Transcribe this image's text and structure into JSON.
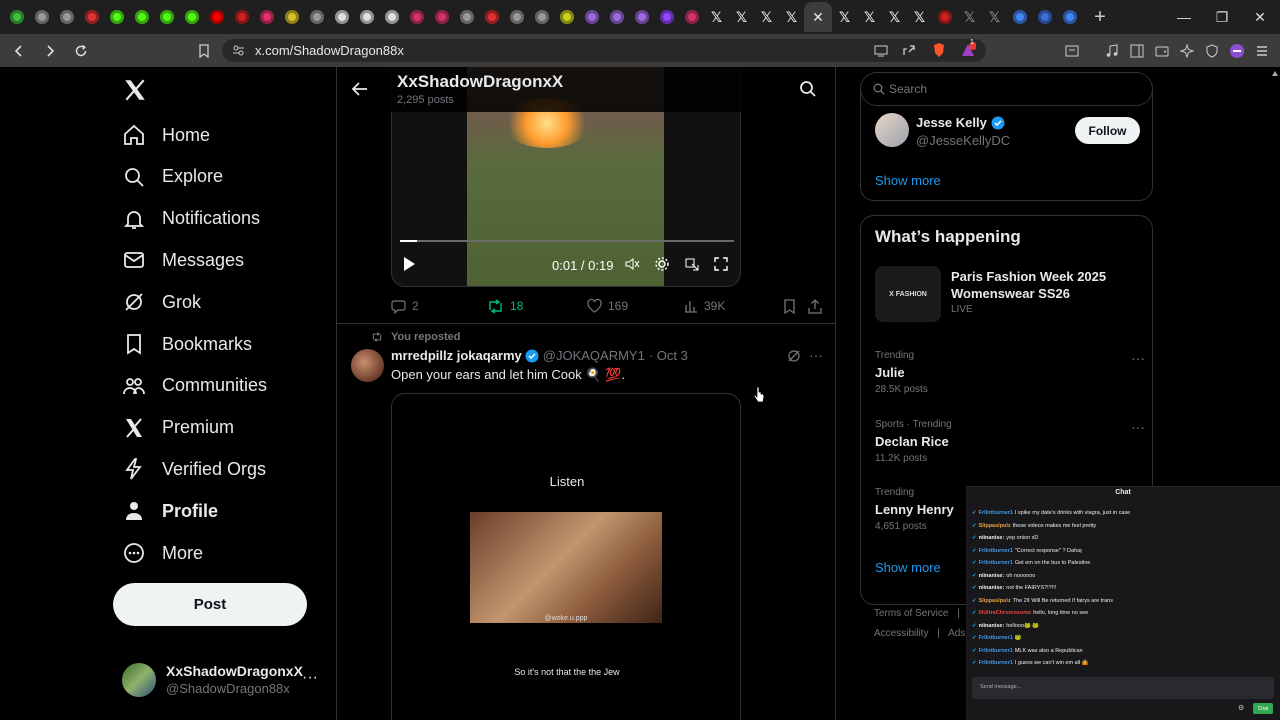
{
  "browser": {
    "tabs": [
      {
        "icon": "green-play-icon",
        "color": "#3fbf3f"
      },
      {
        "icon": "grey-circle-icon",
        "color": "#9a9a9a"
      },
      {
        "icon": "grey-circle-icon",
        "color": "#9a9a9a"
      },
      {
        "icon": "red-circle-icon",
        "color": "#d33"
      },
      {
        "icon": "kick-icon",
        "color": "#53fc18"
      },
      {
        "icon": "kick-icon",
        "color": "#53fc18"
      },
      {
        "icon": "kick-icon",
        "color": "#53fc18"
      },
      {
        "icon": "kick-icon",
        "color": "#53fc18"
      },
      {
        "icon": "youtube-icon",
        "color": "#ff0000"
      },
      {
        "icon": "red-circle-icon",
        "color": "#c22"
      },
      {
        "icon": "instagram-icon",
        "color": "#e1306c"
      },
      {
        "icon": "yellow-circle-icon",
        "color": "#d8c12a"
      },
      {
        "icon": "grey-circle-icon",
        "color": "#9a9a9a"
      },
      {
        "icon": "white-circle-icon",
        "color": "#e0e0e0"
      },
      {
        "icon": "white-circle-icon",
        "color": "#e0e0e0"
      },
      {
        "icon": "white-circle-icon",
        "color": "#e0e0e0"
      },
      {
        "icon": "pink-circle-icon",
        "color": "#d6336c"
      },
      {
        "icon": "pink-circle-icon",
        "color": "#d6336c"
      },
      {
        "icon": "grey-circle-icon",
        "color": "#9a9a9a"
      },
      {
        "icon": "red-circle-icon",
        "color": "#e03131"
      },
      {
        "icon": "grey-circle-icon",
        "color": "#9a9a9a"
      },
      {
        "icon": "grey-circle-icon",
        "color": "#9a9a9a"
      },
      {
        "icon": "yellow-circle-icon",
        "color": "#c9d11c"
      },
      {
        "icon": "purple-circle-icon",
        "color": "#9c6ade"
      },
      {
        "icon": "purple-circle-icon",
        "color": "#9c6ade"
      },
      {
        "icon": "purple-circle-icon",
        "color": "#9c6ade"
      },
      {
        "icon": "twitch-icon",
        "color": "#9146ff"
      },
      {
        "icon": "pink-circle-icon",
        "color": "#d6336c"
      },
      {
        "icon": "x-icon",
        "color": "#e8e8e8"
      },
      {
        "icon": "x-icon",
        "color": "#e8e8e8"
      },
      {
        "icon": "x-icon",
        "color": "#e8e8e8"
      },
      {
        "icon": "x-icon",
        "color": "#e8e8e8"
      },
      {
        "icon": "close-icon",
        "color": "#e8e8e8",
        "active": true
      },
      {
        "icon": "x-icon",
        "color": "#e8e8e8"
      },
      {
        "icon": "x-icon",
        "color": "#e8e8e8"
      },
      {
        "icon": "x-icon",
        "color": "#e8e8e8"
      },
      {
        "icon": "x-icon",
        "color": "#e8e8e8"
      },
      {
        "icon": "red-circle-icon",
        "color": "#c22"
      },
      {
        "icon": "grey-x-icon",
        "color": "#888"
      },
      {
        "icon": "grey-x-icon",
        "color": "#888"
      },
      {
        "icon": "google-icon",
        "color": "#4285f4"
      },
      {
        "icon": "blue-circle-icon",
        "color": "#3b6fd8"
      },
      {
        "icon": "google-icon",
        "color": "#4285f4"
      }
    ],
    "url": "x.com/ShadowDragon88x",
    "extension_badge": "1"
  },
  "nav": {
    "items": [
      {
        "label": "Home",
        "icon": "home-icon"
      },
      {
        "label": "Explore",
        "icon": "search-icon"
      },
      {
        "label": "Notifications",
        "icon": "bell-icon"
      },
      {
        "label": "Messages",
        "icon": "mail-icon"
      },
      {
        "label": "Grok",
        "icon": "grok-icon"
      },
      {
        "label": "Bookmarks",
        "icon": "bookmark-icon"
      },
      {
        "label": "Communities",
        "icon": "communities-icon"
      },
      {
        "label": "Premium",
        "icon": "x-icon"
      },
      {
        "label": "Verified Orgs",
        "icon": "lightning-icon"
      },
      {
        "label": "Profile",
        "icon": "person-icon"
      },
      {
        "label": "More",
        "icon": "more-circle-icon"
      }
    ],
    "post_label": "Post",
    "account": {
      "name": "XxShadowDragonxX",
      "handle": "@ShadowDragon88x"
    }
  },
  "header": {
    "title": "XxShadowDragonxX",
    "posts": "2,295 posts"
  },
  "post1": {
    "video": {
      "time": "0:01 / 0:19",
      "progress": 0.05
    },
    "actions": {
      "replies": "2",
      "reposts": "18",
      "likes": "169",
      "views": "39K"
    }
  },
  "post2": {
    "repost_label": "You reposted",
    "name": "mrredpillz jokaqarmy",
    "handle": "@JOKAQARMY1",
    "date": "· Oct 3",
    "text": "Open your ears and let him Cook 🍳 💯.",
    "video": {
      "title": "Listen",
      "watermark": "@woke.u.ppp",
      "caption": "So it's not that the the Jew"
    }
  },
  "right": {
    "search_placeholder": "Search",
    "suggest": {
      "name": "Jesse Kelly",
      "handle": "@JesseKellyDC",
      "follow": "Follow"
    },
    "show_more": "Show more",
    "happening_title": "What’s happening",
    "event": {
      "image_text": "X FASHION",
      "title": "Paris Fashion Week 2025 Womenswear SS26",
      "status": "LIVE"
    },
    "trends": [
      {
        "context": "Trending",
        "title": "Julie",
        "count": "28.5K posts"
      },
      {
        "context": "Sports · Trending",
        "title": "Declan Rice",
        "count": "11.2K posts"
      },
      {
        "context": "Trending",
        "title": "Lenny Henry",
        "count": "4,651 posts"
      }
    ],
    "show_more_2": "Show more",
    "footer": {
      "terms": "Terms of Service",
      "sep": "|",
      "f2": "F",
      "accessibility": "Accessibility",
      "ads": "Ads i"
    }
  },
  "chat": {
    "title": "Chat",
    "messages": [
      {
        "user": "Fr0ntburner1",
        "color": "#3f9ae6",
        "text": "I spike my date's drinks with viagra, just in case"
      },
      {
        "user": "Slippaslpulz",
        "color": "#e6a23f",
        "text": "these videos makes me feel pretty"
      },
      {
        "user": "niinanise:",
        "color": "#efeff1",
        "text": "yep onion xD"
      },
      {
        "user": "Fr0ntburner1",
        "color": "#3f9ae6",
        "text": "\"Correct response\" ? Dafuq"
      },
      {
        "user": "Fr0ntburner1",
        "color": "#3f9ae6",
        "text": "Get em on the bus to Palestine"
      },
      {
        "user": "niinanise:",
        "color": "#efeff1",
        "text": "oh noooooo"
      },
      {
        "user": "niinanise:",
        "color": "#efeff1",
        "text": "not the FAIRYS?!?!!!"
      },
      {
        "user": "Slippaslpulz",
        "color": "#e6a23f",
        "text": "The 2¢ Will Be returned If fairys are trans"
      },
      {
        "user": "0hXtraChromosome",
        "color": "#e6453f",
        "text": "hello, long time no see"
      },
      {
        "user": "niinanise:",
        "color": "#efeff1",
        "text": "hellooo🐸 🐸"
      },
      {
        "user": "Fr0ntburner1",
        "color": "#3f9ae6",
        "text": "🐸"
      },
      {
        "user": "Fr0ntburner1",
        "color": "#3f9ae6",
        "text": "MLK was also a Republican"
      },
      {
        "user": "Fr0ntburner1",
        "color": "#3f9ae6",
        "text": "I guess we can't win em all 🤷"
      }
    ],
    "input_placeholder": "Send message...",
    "send_label": "Chat"
  }
}
